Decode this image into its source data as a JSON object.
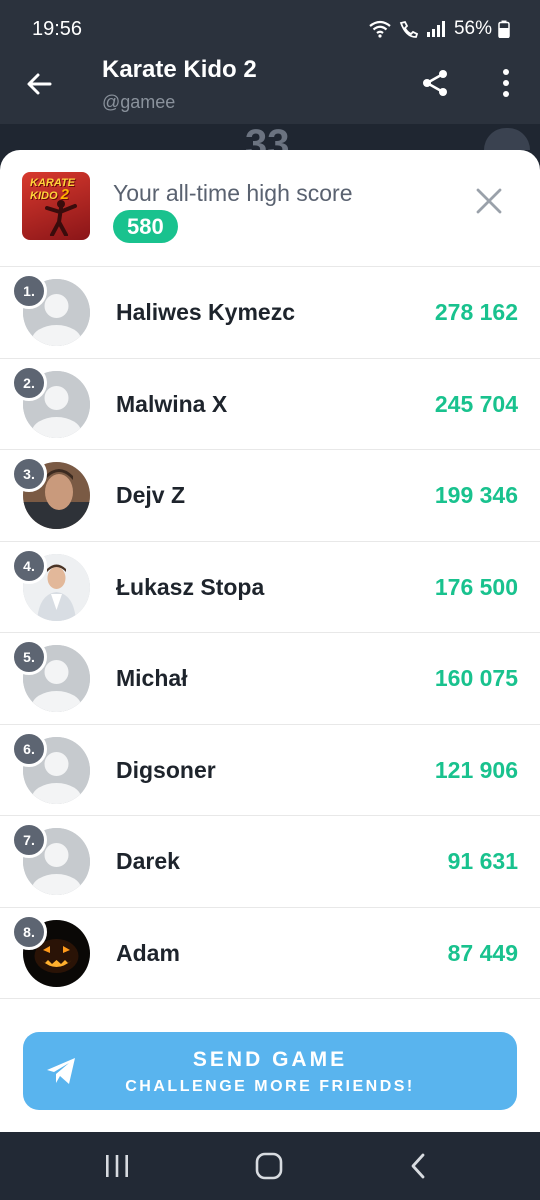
{
  "status": {
    "time": "19:56",
    "battery": "56%"
  },
  "appbar": {
    "title": "Karate Kido 2",
    "subtitle": "@gamee"
  },
  "background": {
    "score_peek": "33"
  },
  "high_score": {
    "label": "Your all-time high score",
    "value": "580",
    "game_logo": "KARATE KIDO 2"
  },
  "leaderboard": [
    {
      "rank": "1.",
      "name": "Haliwes Kymezc",
      "score": "278 162",
      "avatar": "default"
    },
    {
      "rank": "2.",
      "name": "Malwina X",
      "score": "245 704",
      "avatar": "default"
    },
    {
      "rank": "3.",
      "name": "Dejv Z",
      "score": "199 346",
      "avatar": "photo-man"
    },
    {
      "rank": "4.",
      "name": "Łukasz Stopa",
      "score": "176 500",
      "avatar": "photo-suit"
    },
    {
      "rank": "5.",
      "name": "Michał",
      "score": "160 075",
      "avatar": "default"
    },
    {
      "rank": "6.",
      "name": "Digsoner",
      "score": "121 906",
      "avatar": "default"
    },
    {
      "rank": "7.",
      "name": "Darek",
      "score": "91 631",
      "avatar": "default"
    },
    {
      "rank": "8.",
      "name": "Adam",
      "score": "87 449",
      "avatar": "pumpkin"
    }
  ],
  "send_button": {
    "line1": "SEND GAME",
    "line2": "CHALLENGE MORE FRIENDS!"
  },
  "colors": {
    "accent_green": "#19c28e",
    "button_blue": "#59b4ee",
    "appbar": "#2b323d"
  }
}
